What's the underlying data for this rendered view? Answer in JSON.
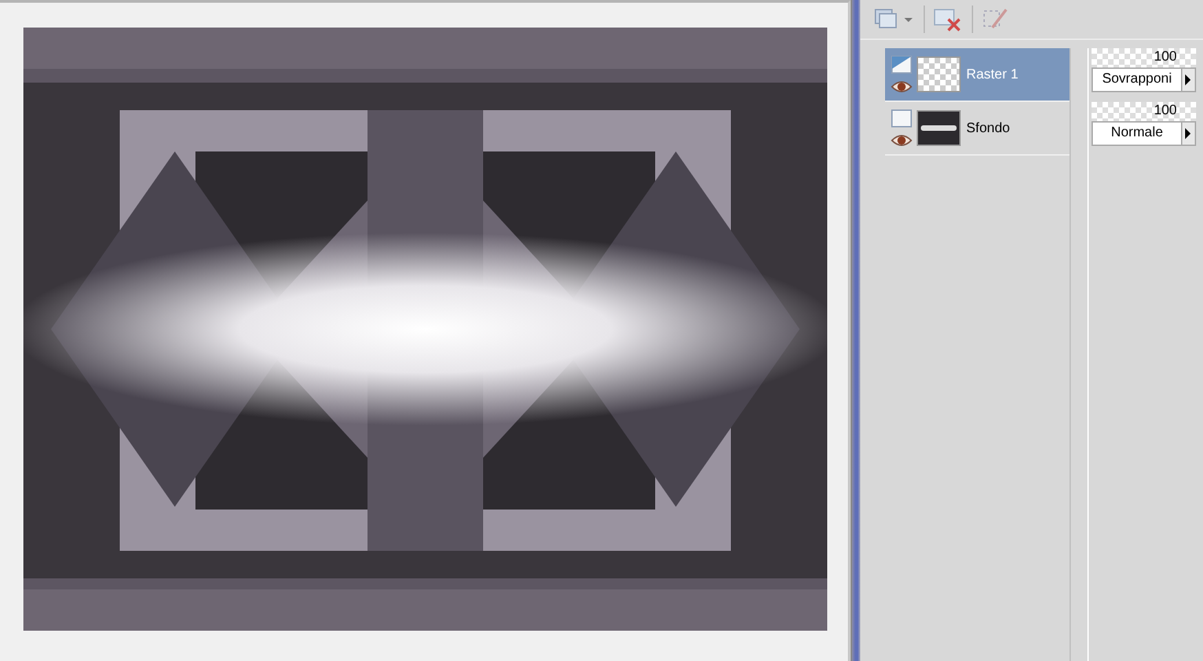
{
  "layers": [
    {
      "name": "Raster 1",
      "kind": "transparent",
      "selected": true,
      "opacity": "100",
      "level": 1,
      "blend_mode": "Sovrapponi"
    },
    {
      "name": "Sfondo",
      "selected": false,
      "opacity": "100",
      "level": 1,
      "blend_mode": "Normale"
    }
  ]
}
